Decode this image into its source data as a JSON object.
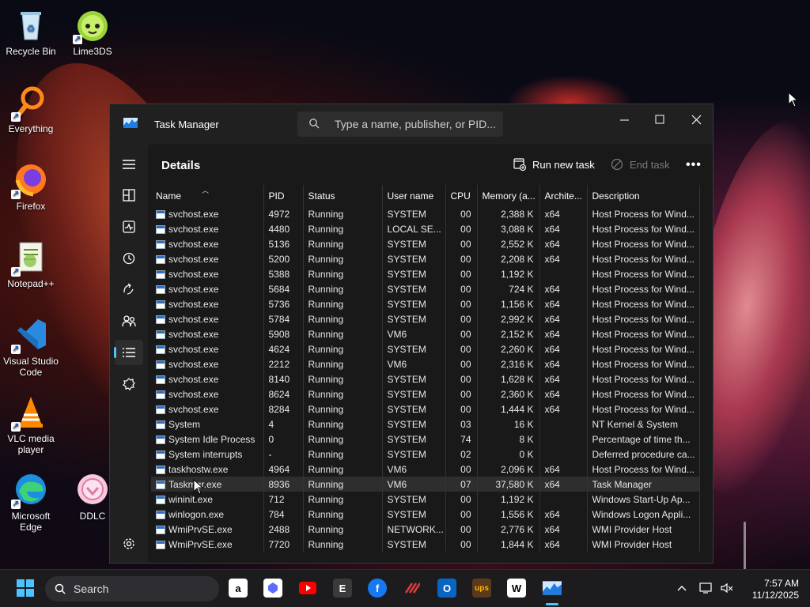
{
  "desktop": {
    "icons": [
      {
        "label": "Recycle Bin",
        "icon": "recycle-bin-icon"
      },
      {
        "label": "Lime3DS",
        "icon": "lime3ds-icon"
      },
      {
        "label": "Everything",
        "icon": "everything-icon"
      },
      {
        "label": "Firefox",
        "icon": "firefox-icon"
      },
      {
        "label": "Notepad++",
        "icon": "notepadpp-icon"
      },
      {
        "label": "Visual Studio Code",
        "icon": "vscode-icon"
      },
      {
        "label": "VLC media player",
        "icon": "vlc-icon"
      },
      {
        "label": "Microsoft Edge",
        "icon": "edge-icon"
      },
      {
        "label": "DDLC",
        "icon": "ddlc-icon"
      }
    ]
  },
  "window": {
    "title": "Task Manager",
    "search_placeholder": "Type a name, publisher, or PID...",
    "accent": "#4cc2ff"
  },
  "details": {
    "title": "Details",
    "run_new_task": "Run new task",
    "end_task": "End task"
  },
  "columns": [
    "Name",
    "PID",
    "Status",
    "User name",
    "CPU",
    "Memory (a...",
    "Archite...",
    "Description"
  ],
  "rows": [
    [
      "svchost.exe",
      "4972",
      "Running",
      "SYSTEM",
      "00",
      "2,388 K",
      "x64",
      "Host Process for Wind..."
    ],
    [
      "svchost.exe",
      "4480",
      "Running",
      "LOCAL SE...",
      "00",
      "3,088 K",
      "x64",
      "Host Process for Wind..."
    ],
    [
      "svchost.exe",
      "5136",
      "Running",
      "SYSTEM",
      "00",
      "2,552 K",
      "x64",
      "Host Process for Wind..."
    ],
    [
      "svchost.exe",
      "5200",
      "Running",
      "SYSTEM",
      "00",
      "2,208 K",
      "x64",
      "Host Process for Wind..."
    ],
    [
      "svchost.exe",
      "5388",
      "Running",
      "SYSTEM",
      "00",
      "1,192 K",
      "",
      "Host Process for Wind..."
    ],
    [
      "svchost.exe",
      "5684",
      "Running",
      "SYSTEM",
      "00",
      "724 K",
      "x64",
      "Host Process for Wind..."
    ],
    [
      "svchost.exe",
      "5736",
      "Running",
      "SYSTEM",
      "00",
      "1,156 K",
      "x64",
      "Host Process for Wind..."
    ],
    [
      "svchost.exe",
      "5784",
      "Running",
      "SYSTEM",
      "00",
      "2,992 K",
      "x64",
      "Host Process for Wind..."
    ],
    [
      "svchost.exe",
      "5908",
      "Running",
      "VM6",
      "00",
      "2,152 K",
      "x64",
      "Host Process for Wind..."
    ],
    [
      "svchost.exe",
      "4624",
      "Running",
      "SYSTEM",
      "00",
      "2,260 K",
      "x64",
      "Host Process for Wind..."
    ],
    [
      "svchost.exe",
      "2212",
      "Running",
      "VM6",
      "00",
      "2,316 K",
      "x64",
      "Host Process for Wind..."
    ],
    [
      "svchost.exe",
      "8140",
      "Running",
      "SYSTEM",
      "00",
      "1,628 K",
      "x64",
      "Host Process for Wind..."
    ],
    [
      "svchost.exe",
      "8624",
      "Running",
      "SYSTEM",
      "00",
      "2,360 K",
      "x64",
      "Host Process for Wind..."
    ],
    [
      "svchost.exe",
      "8284",
      "Running",
      "SYSTEM",
      "00",
      "1,444 K",
      "x64",
      "Host Process for Wind..."
    ],
    [
      "System",
      "4",
      "Running",
      "SYSTEM",
      "03",
      "16 K",
      "",
      "NT Kernel & System"
    ],
    [
      "System Idle Process",
      "0",
      "Running",
      "SYSTEM",
      "74",
      "8 K",
      "",
      "Percentage of time th..."
    ],
    [
      "System interrupts",
      "-",
      "Running",
      "SYSTEM",
      "02",
      "0 K",
      "",
      "Deferred procedure ca..."
    ],
    [
      "taskhostw.exe",
      "4964",
      "Running",
      "VM6",
      "00",
      "2,096 K",
      "x64",
      "Host Process for Wind..."
    ],
    [
      "Taskmgr.exe",
      "8936",
      "Running",
      "VM6",
      "07",
      "37,580 K",
      "x64",
      "Task Manager"
    ],
    [
      "wininit.exe",
      "712",
      "Running",
      "SYSTEM",
      "00",
      "1,192 K",
      "",
      "Windows Start-Up Ap..."
    ],
    [
      "winlogon.exe",
      "784",
      "Running",
      "SYSTEM",
      "00",
      "1,556 K",
      "x64",
      "Windows Logon Appli..."
    ],
    [
      "WmiPrvSE.exe",
      "2488",
      "Running",
      "NETWORK...",
      "00",
      "2,776 K",
      "x64",
      "WMI Provider Host"
    ],
    [
      "WmiPrvSE.exe",
      "7720",
      "Running",
      "SYSTEM",
      "00",
      "1,844 K",
      "x64",
      "WMI Provider Host"
    ]
  ],
  "selected_row": 18,
  "taskbar": {
    "search_label": "Search",
    "time": "7:57 AM",
    "date": "11/12/2025"
  }
}
